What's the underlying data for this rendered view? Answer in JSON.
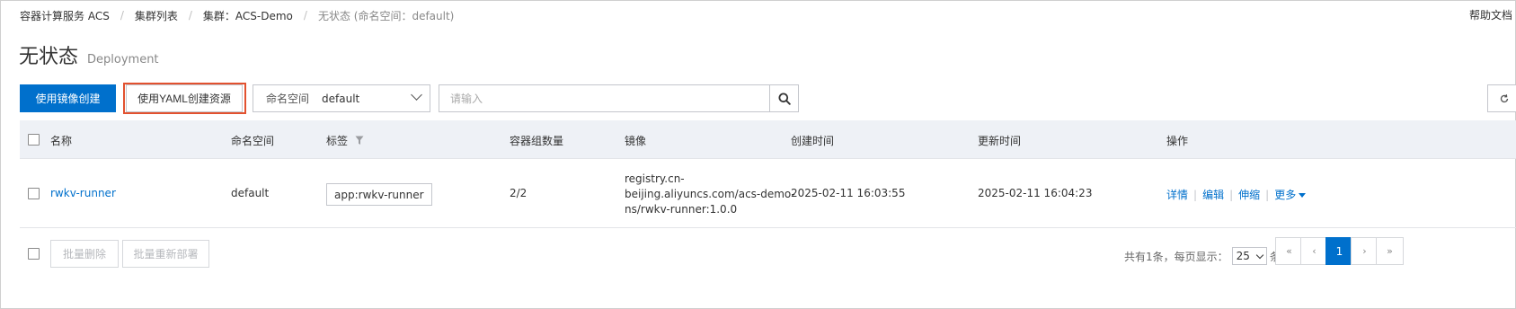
{
  "breadcrumb": {
    "items": [
      "容器计算服务 ACS",
      "集群列表",
      "集群：ACS-Demo"
    ],
    "current": "无状态 (命名空间：default)"
  },
  "help_link": "帮助文档",
  "page": {
    "title": "无状态",
    "subtitle": "Deployment"
  },
  "toolbar": {
    "create_from_image": "使用镜像创建",
    "create_from_yaml": "使用YAML创建资源",
    "namespace_label": "命名空间",
    "namespace_value": "default",
    "search_placeholder": "请输入"
  },
  "table": {
    "columns": [
      "名称",
      "命名空间",
      "标签",
      "容器组数量",
      "镜像",
      "创建时间",
      "更新时间",
      "操作"
    ],
    "rows": [
      {
        "name": "rwkv-runner",
        "namespace": "default",
        "label": "app:rwkv-runner",
        "pods": "2/2",
        "image_lines": [
          "registry.cn-",
          "beijing.aliyuncs.com/acs-demo-",
          "ns/rwkv-runner:1.0.0"
        ],
        "created": "2025-02-11 16:03:55",
        "updated": "2025-02-11 16:04:23",
        "actions": [
          "详情",
          "编辑",
          "伸缩",
          "更多"
        ]
      }
    ]
  },
  "footer": {
    "batch_delete": "批量删除",
    "batch_redeploy": "批量重新部署",
    "total_text": "共有1条，每页显示：",
    "page_size": "25",
    "unit": "条",
    "pages": [
      "«",
      "‹",
      "1",
      "›",
      "»"
    ]
  },
  "colors": {
    "primary": "#0070cc",
    "highlight_border": "#e2512f",
    "header_bg": "#eef1f6"
  }
}
